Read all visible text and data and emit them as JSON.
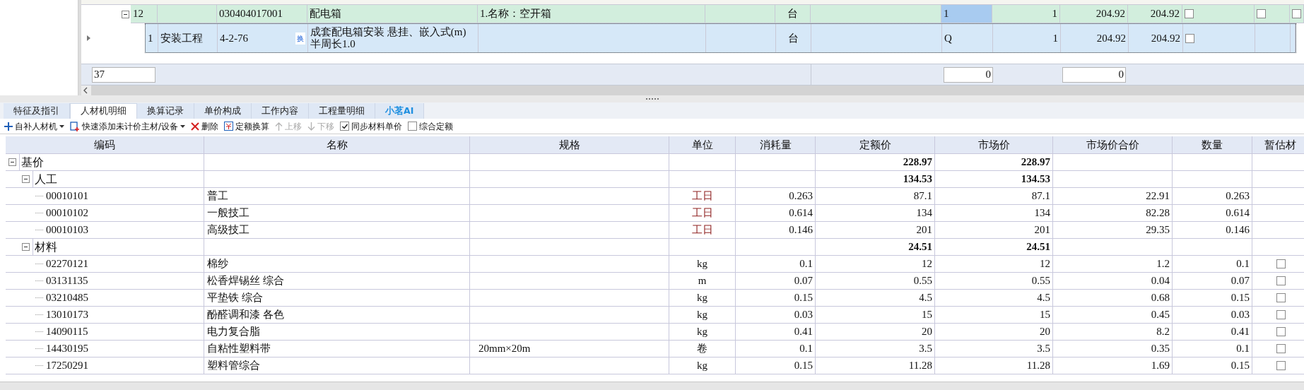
{
  "upper_grid": {
    "rows": [
      {
        "kind": "list_item",
        "selected": false,
        "expanded": true,
        "cells": [
          {
            "kind": "text",
            "text": "12",
            "selected": false
          },
          {
            "kind": "empty"
          },
          {
            "kind": "text",
            "text": "030404017001",
            "selected": false
          },
          {
            "kind": "text",
            "text": "配电箱",
            "selected": false
          },
          {
            "kind": "text",
            "text": "1.名称：空开箱",
            "selected": false
          },
          {
            "kind": "empty"
          },
          {
            "kind": "text",
            "text": "台",
            "selected": false
          },
          {
            "kind": "empty"
          },
          {
            "kind": "text",
            "text": "1",
            "selected": true
          },
          {
            "kind": "text",
            "text": "1",
            "selected": false
          },
          {
            "kind": "text",
            "text": "204.92",
            "selected": false
          },
          {
            "kind": "text",
            "text": "204.92",
            "selected": false
          },
          {
            "kind": "checkbox",
            "checked": false
          },
          {
            "kind": "checkbox",
            "checked": false
          },
          {
            "kind": "checkbox",
            "checked": false
          }
        ]
      },
      {
        "kind": "quota",
        "selected": true,
        "cells": [
          {
            "kind": "text",
            "text": "1",
            "selected": false
          },
          {
            "kind": "text",
            "text": "安装工程",
            "selected": false
          },
          {
            "kind": "text",
            "text": "4-2-76",
            "badge": "换",
            "selected": false
          },
          {
            "kind": "text",
            "text": "成套配电箱安装 悬挂、嵌入式(m) 半周长1.0",
            "selected": false
          },
          {
            "kind": "empty"
          },
          {
            "kind": "empty"
          },
          {
            "kind": "text",
            "text": "台",
            "selected": false
          },
          {
            "kind": "empty"
          },
          {
            "kind": "text",
            "text": "Q",
            "selected": false
          },
          {
            "kind": "text",
            "text": "1",
            "selected": false
          },
          {
            "kind": "text",
            "text": "204.92",
            "selected": false
          },
          {
            "kind": "text",
            "text": "204.92",
            "selected": false
          },
          {
            "kind": "checkbox",
            "checked": false
          },
          {
            "kind": "empty"
          },
          {
            "kind": "empty"
          }
        ]
      }
    ],
    "footer": {
      "count": "37",
      "total_1": "0",
      "total_2": "0"
    }
  },
  "tabs": [
    {
      "label": "特征及指引",
      "kind": "normal",
      "selected": false
    },
    {
      "label": "人材机明细",
      "kind": "normal",
      "selected": true
    },
    {
      "label": "换算记录",
      "kind": "normal",
      "selected": false
    },
    {
      "label": "单价构成",
      "kind": "normal",
      "selected": false
    },
    {
      "label": "工作内容",
      "kind": "normal",
      "selected": false
    },
    {
      "label": "工程量明细",
      "kind": "normal",
      "selected": false
    },
    {
      "label": "小茗AI",
      "kind": "ai",
      "selected": false
    }
  ],
  "toolbar": [
    {
      "kind": "add",
      "label": "自补人材机",
      "dropdown": true,
      "disabled": false
    },
    {
      "kind": "quick_add",
      "label": "快速添加未计价主材/设备",
      "dropdown": true,
      "disabled": false
    },
    {
      "kind": "delete",
      "label": "删除",
      "dropdown": false,
      "disabled": false
    },
    {
      "kind": "convert",
      "label": "定额换算",
      "dropdown": false,
      "disabled": false
    },
    {
      "kind": "move_up",
      "label": "上移",
      "dropdown": false,
      "disabled": true
    },
    {
      "kind": "move_down",
      "label": "下移",
      "dropdown": false,
      "disabled": true
    },
    {
      "kind": "checkbox",
      "label": "同步材料单价",
      "checked": true
    },
    {
      "kind": "checkbox",
      "label": "综合定额",
      "checked": false
    }
  ],
  "table": {
    "columns": [
      "编码",
      "名称",
      "规格",
      "单位",
      "消耗量",
      "定额价",
      "市场价",
      "市场价合价",
      "数量",
      "暂估材"
    ],
    "rows": [
      {
        "kind": "category",
        "code": "基价",
        "quota_price": "228.97",
        "market_price": "228.97",
        "expanded": true,
        "children": [
          {
            "kind": "category",
            "code": "人工",
            "quota_price": "134.53",
            "market_price": "134.53",
            "expanded": true,
            "children": [
              {
                "kind": "labor",
                "code": "00010101",
                "name": "普工",
                "unit": "工日",
                "consumption": "0.263",
                "quota_price": "87.1",
                "market_price": "87.1",
                "market_total": "22.91",
                "quantity": "0.263"
              },
              {
                "kind": "labor",
                "code": "00010102",
                "name": "一般技工",
                "unit": "工日",
                "consumption": "0.614",
                "quota_price": "134",
                "market_price": "134",
                "market_total": "82.28",
                "quantity": "0.614"
              },
              {
                "kind": "labor",
                "code": "00010103",
                "name": "高级技工",
                "unit": "工日",
                "consumption": "0.146",
                "quota_price": "201",
                "market_price": "201",
                "market_total": "29.35",
                "quantity": "0.146"
              }
            ]
          },
          {
            "kind": "category",
            "code": "材料",
            "quota_price": "24.51",
            "market_price": "24.51",
            "expanded": true,
            "children": [
              {
                "kind": "material",
                "code": "02270121",
                "name": "棉纱",
                "unit": "kg",
                "consumption": "0.1",
                "quota_price": "12",
                "market_price": "12",
                "market_total": "1.2",
                "quantity": "0.1",
                "provisional": false
              },
              {
                "kind": "material",
                "code": "03131135",
                "name": "松香焊锡丝 综合",
                "unit": "m",
                "consumption": "0.07",
                "quota_price": "0.55",
                "market_price": "0.55",
                "market_total": "0.04",
                "quantity": "0.07",
                "provisional": false
              },
              {
                "kind": "material",
                "code": "03210485",
                "name": "平垫铁 综合",
                "unit": "kg",
                "consumption": "0.15",
                "quota_price": "4.5",
                "market_price": "4.5",
                "market_total": "0.68",
                "quantity": "0.15",
                "provisional": false
              },
              {
                "kind": "material",
                "code": "13010173",
                "name": "酚醛调和漆 各色",
                "unit": "kg",
                "consumption": "0.03",
                "quota_price": "15",
                "market_price": "15",
                "market_total": "0.45",
                "quantity": "0.03",
                "provisional": false
              },
              {
                "kind": "material",
                "code": "14090115",
                "name": "电力复合脂",
                "unit": "kg",
                "consumption": "0.41",
                "quota_price": "20",
                "market_price": "20",
                "market_total": "8.2",
                "quantity": "0.41",
                "provisional": false
              },
              {
                "kind": "material",
                "code": "14430195",
                "name": "自粘性塑料带",
                "spec": "20mm×20m",
                "unit": "卷",
                "consumption": "0.1",
                "quota_price": "3.5",
                "market_price": "3.5",
                "market_total": "0.35",
                "quantity": "0.1",
                "provisional": false
              },
              {
                "kind": "material",
                "code": "17250291",
                "name": "塑料管综合",
                "unit": "kg",
                "consumption": "0.15",
                "quota_price": "11.28",
                "market_price": "11.28",
                "market_total": "1.69",
                "quantity": "0.15",
                "provisional": false
              }
            ]
          }
        ]
      }
    ]
  }
}
